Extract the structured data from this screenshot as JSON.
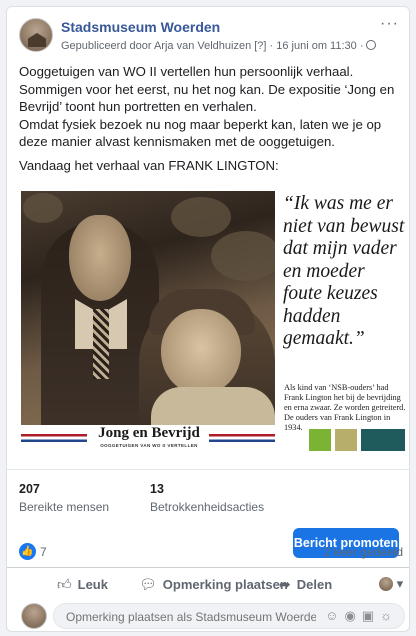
{
  "post": {
    "page_name": "Stadsmuseum Woerden",
    "meta": "Gepubliceerd door Arja van Veldhuizen [?] · 16 juni om 11:30 ·",
    "more": "···",
    "paragraphs": [
      "Ooggetuigen van WO II vertellen hun persoonlijk verhaal. Sommigen voor het eerst, nu het nog kan. De expositie ‘Jong en Bevrijd’ toont hun portretten en verhalen.",
      "Omdat fysiek bezoek nu nog maar beperkt kan, laten we je op deze manier alvast kennismaken met de ooggetuigen.",
      "Vandaag het verhaal van FRANK LINGTON:"
    ]
  },
  "poster": {
    "quote": "“Ik was me er niet van bewust dat mijn vader en moeder foute keuzes hadden gemaakt.”",
    "caption": "Als kind van ‘NSB-ouders’ had Frank Lington het bij de bevrijding en erna zwaar. Ze worden getreiterd. De ouders van Frank Lington in 1934.",
    "banner_title": "Jong en Bevrijd",
    "banner_subtitle": "OOGGETUIGEN VAN WO II VERTELLEN",
    "flag_colors": [
      "#ae1c28",
      "#ffffff",
      "#21468b"
    ]
  },
  "insights": {
    "reach_value": "207",
    "reach_label": "Bereikte mensen",
    "engagement_value": "13",
    "engagement_label": "Betrokkenheidsacties",
    "promote_label": "Bericht promoten"
  },
  "reactions": {
    "count": "7",
    "shares": "2 keer gedeeld"
  },
  "actions": {
    "like": "Leuk",
    "comment": "Opmerking plaatsen",
    "share": "Delen"
  },
  "comment_box": {
    "placeholder": "Opmerking plaatsen als Stadsmuseum Woerden"
  },
  "colors": {
    "link_blue": "#385898",
    "accent": "#1b74e4"
  }
}
